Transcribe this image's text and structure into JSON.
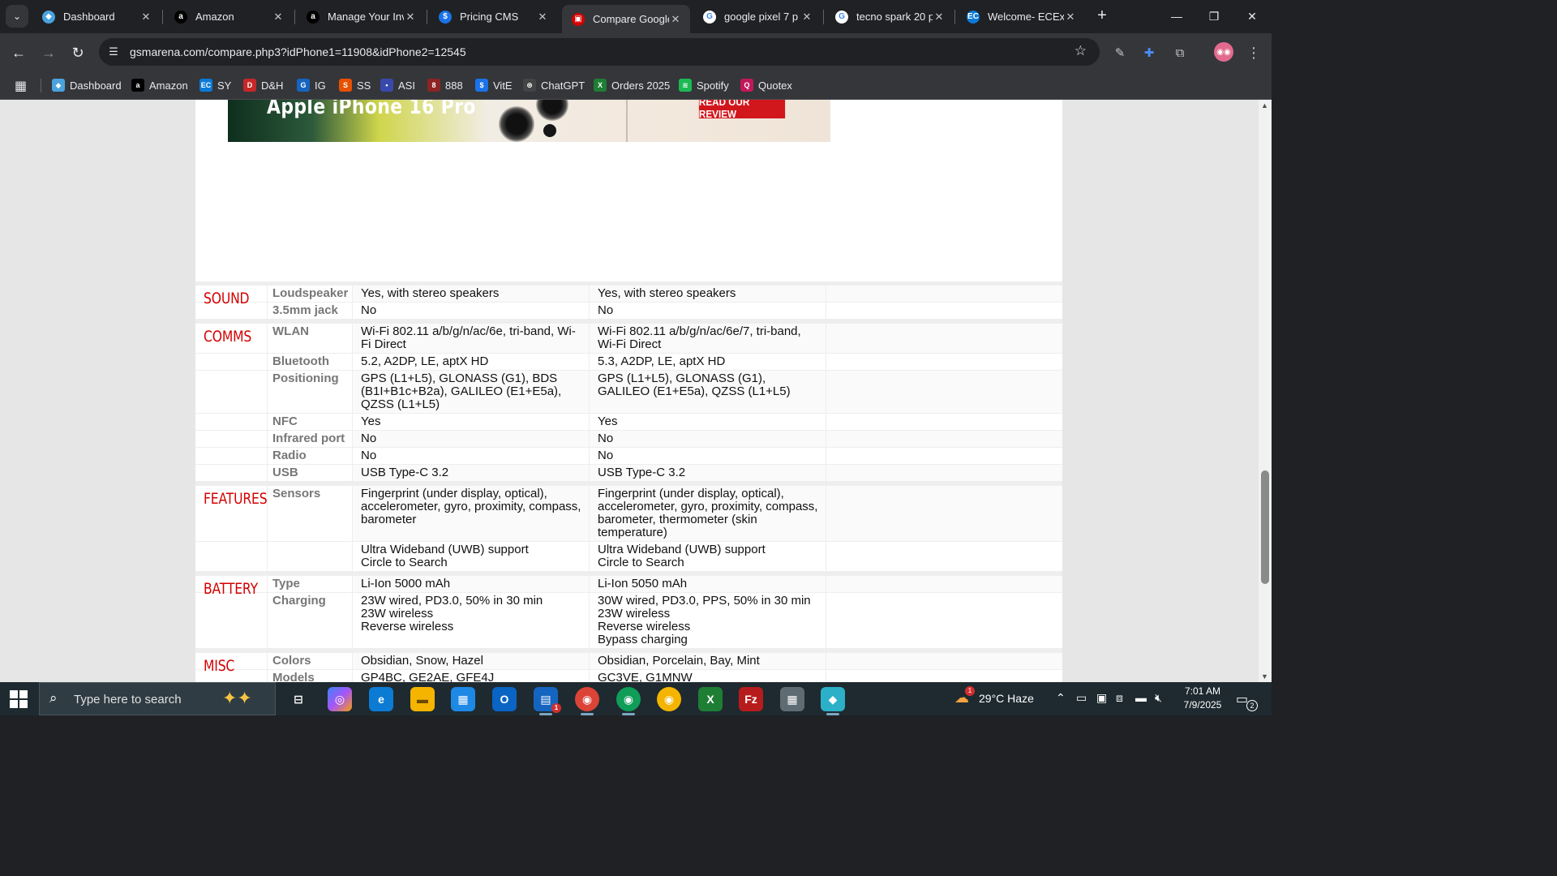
{
  "browser": {
    "tabs": [
      {
        "title": "Dashboard",
        "icon": "dashboard-favicon",
        "color": "#4aa3df",
        "glyph": "◆"
      },
      {
        "title": "Amazon",
        "icon": "amazon-favicon",
        "color": "#000000",
        "glyph": "a"
      },
      {
        "title": "Manage Your Inv",
        "icon": "amazon-favicon",
        "color": "#000000",
        "glyph": "a"
      },
      {
        "title": "Pricing CMS",
        "icon": "dollar-favicon",
        "color": "#1a73e8",
        "glyph": "$"
      },
      {
        "title": "Compare Google",
        "icon": "gsmarena-favicon",
        "color": "#d50000",
        "glyph": "▣"
      },
      {
        "title": "google pixel 7 p",
        "icon": "google-favicon",
        "color": "#ffffff",
        "glyph": "G"
      },
      {
        "title": "tecno spark 20 p",
        "icon": "google-favicon",
        "color": "#ffffff",
        "glyph": "G"
      },
      {
        "title": "Welcome- ECExp",
        "icon": "ec-favicon",
        "color": "#0b7ad8",
        "glyph": "EC"
      }
    ],
    "active_tab": 4,
    "url": "gsmarena.com/compare.php3?idPhone1=11908&idPhone2=12545",
    "bookmarks": [
      {
        "label": "Dashboard",
        "color": "#4aa3df",
        "glyph": "◆"
      },
      {
        "label": "Amazon",
        "color": "#000000",
        "glyph": "a"
      },
      {
        "label": "SY",
        "color": "#0b7ad8",
        "glyph": "EC"
      },
      {
        "label": "D&H",
        "color": "#c62828",
        "glyph": "D"
      },
      {
        "label": "IG",
        "color": "#1565c0",
        "glyph": "G"
      },
      {
        "label": "SS",
        "color": "#e65100",
        "glyph": "S"
      },
      {
        "label": "ASI",
        "color": "#3949ab",
        "glyph": "•"
      },
      {
        "label": "888",
        "color": "#8e2424",
        "glyph": "8"
      },
      {
        "label": "VitE",
        "color": "#1a73e8",
        "glyph": "$"
      },
      {
        "label": "ChatGPT",
        "color": "#444444",
        "glyph": "⊛"
      },
      {
        "label": "Orders 2025",
        "color": "#1e7e34",
        "glyph": "X"
      },
      {
        "label": "Spotify",
        "color": "#1db954",
        "glyph": "≋"
      },
      {
        "label": "Quotex",
        "color": "#c2185b",
        "glyph": "Q"
      }
    ]
  },
  "ad": {
    "headline": "Apple iPhone 16 Pro",
    "cta": "READ OUR REVIEW"
  },
  "spec_groups": [
    {
      "category": "SOUND",
      "rows": [
        {
          "label": "Loudspeaker",
          "phone1": "Yes, with stereo speakers",
          "phone2": "Yes, with stereo speakers"
        },
        {
          "label": "3.5mm jack",
          "phone1": "No",
          "phone2": "No"
        }
      ]
    },
    {
      "category": "COMMS",
      "rows": [
        {
          "label": "WLAN",
          "phone1": "Wi-Fi 802.11 a/b/g/n/ac/6e, tri-band, Wi-Fi Direct",
          "phone2": "Wi-Fi 802.11 a/b/g/n/ac/6e/7, tri-band, Wi-Fi Direct"
        },
        {
          "label": "Bluetooth",
          "phone1": "5.2, A2DP, LE, aptX HD",
          "phone2": "5.3, A2DP, LE, aptX HD"
        },
        {
          "label": "Positioning",
          "phone1": "GPS (L1+L5), GLONASS (G1), BDS (B1I+B1c+B2a), GALILEO (E1+E5a), QZSS (L1+L5)",
          "phone2": "GPS (L1+L5), GLONASS (G1), GALILEO (E1+E5a), QZSS (L1+L5)"
        },
        {
          "label": "NFC",
          "phone1": "Yes",
          "phone2": "Yes"
        },
        {
          "label": "Infrared port",
          "phone1": "No",
          "phone2": "No"
        },
        {
          "label": "Radio",
          "phone1": "No",
          "phone2": "No"
        },
        {
          "label": "USB",
          "phone1": "USB Type-C 3.2",
          "phone2": "USB Type-C 3.2"
        }
      ]
    },
    {
      "category": "FEATURES",
      "rows": [
        {
          "label": "Sensors",
          "phone1": "Fingerprint (under display, optical), accelerometer, gyro, proximity, compass, barometer",
          "phone2": "Fingerprint (under display, optical), accelerometer, gyro, proximity, compass, barometer, thermometer (skin temperature)"
        },
        {
          "label": "",
          "phone1": "Ultra Wideband (UWB) support\nCircle to Search",
          "phone2": "Ultra Wideband (UWB) support\nCircle to Search"
        }
      ]
    },
    {
      "category": "BATTERY",
      "rows": [
        {
          "label": "Type",
          "phone1": "Li-Ion 5000 mAh",
          "phone2": "Li-Ion 5050 mAh"
        },
        {
          "label": "Charging",
          "phone1": "23W wired, PD3.0, 50% in 30 min\n23W wireless\nReverse wireless",
          "phone2": "30W wired, PD3.0, PPS, 50% in 30 min\n23W wireless\nReverse wireless\nBypass charging"
        }
      ]
    },
    {
      "category": "MISC",
      "rows": [
        {
          "label": "Colors",
          "phone1": "Obsidian, Snow, Hazel",
          "phone2": "Obsidian, Porcelain, Bay, Mint"
        },
        {
          "label": "Models",
          "phone1": "GP4BC, GE2AE, GFE4J",
          "phone2": "GC3VE, G1MNW"
        }
      ]
    }
  ],
  "taskbar": {
    "search_placeholder": "Type here to search",
    "weather": "29°C  Haze",
    "weather_badge": "1",
    "time": "7:01 AM",
    "date": "7/9/2025",
    "notification_count": "2",
    "outlook_badge": "1"
  }
}
